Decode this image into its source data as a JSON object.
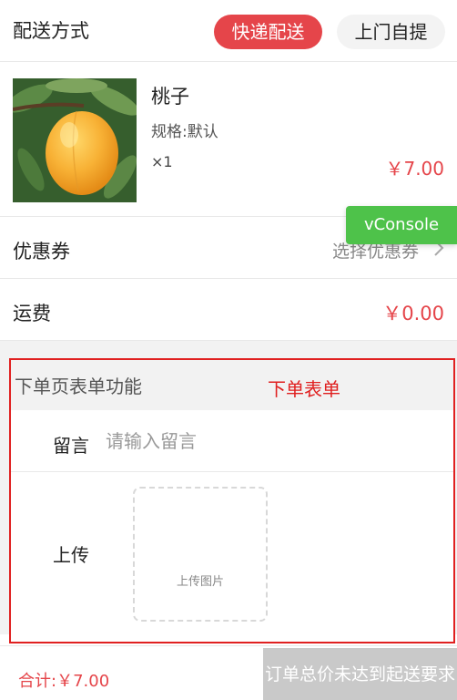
{
  "delivery": {
    "title": "配送方式",
    "options": [
      "快递配送",
      "上门自提"
    ],
    "selected": "快递配送"
  },
  "product": {
    "image_icon": "peach-photo",
    "name": "桃子",
    "spec": "规格:默认",
    "quantity": "×1",
    "price": "￥7.00"
  },
  "vconsole": {
    "label": "vConsole"
  },
  "coupon": {
    "label": "优惠券",
    "value": "选择优惠券",
    "icon": "chevron-right-icon"
  },
  "shipping": {
    "label": "运费",
    "value": "￥0.00"
  },
  "order_form": {
    "title": "下单页表单功能",
    "annotation": "下单表单",
    "message_label": "留言",
    "message_placeholder": "请输入留言",
    "message_value": "",
    "upload_label": "上传",
    "upload_text": "上传图片"
  },
  "footer": {
    "total": "合计:￥7.00",
    "submit_label": "订单总价未达到起送要求"
  },
  "colors": {
    "accent": "#e5454a",
    "annotation": "#e02020",
    "vconsole": "#4ec24a",
    "disabled_button": "#c9c9c9"
  }
}
